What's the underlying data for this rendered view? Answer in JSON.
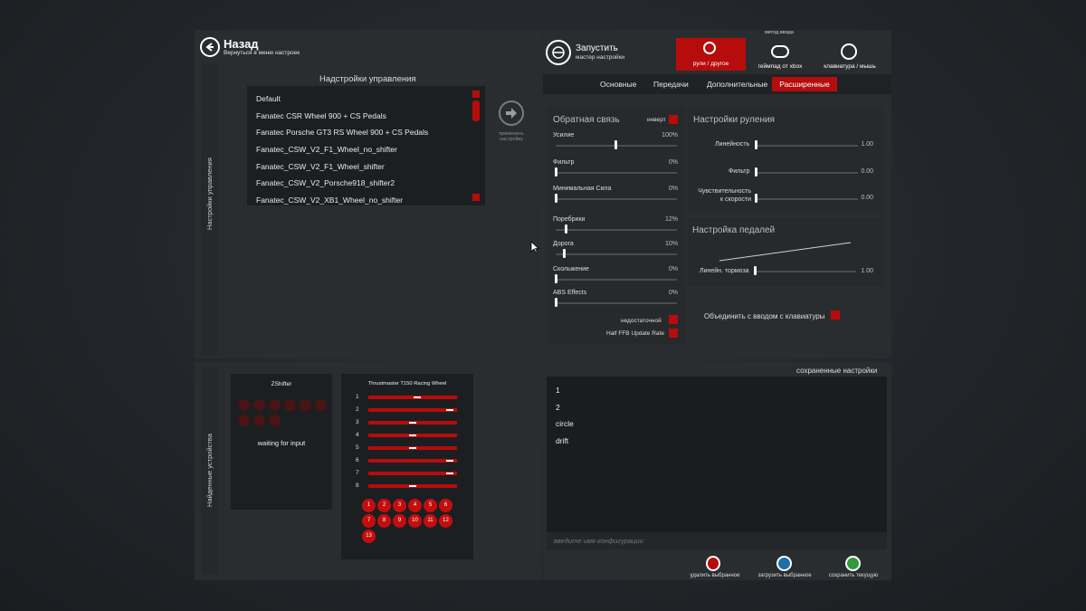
{
  "header": {
    "back_title": "Назад",
    "back_subtitle": "Вернуться в меню настроек",
    "launch_title": "Запустить",
    "launch_subtitle": "мастер настройки",
    "input_method_label": "метод ввода",
    "input_methods": [
      "рули / другое",
      "геймпад от xbox",
      "клавиатура / мышь"
    ]
  },
  "tabs": [
    "Основные",
    "Передачи",
    "Дополнительные",
    "Расширенные"
  ],
  "left": {
    "side_label_top": "Настройки управления",
    "side_label_bottom": "Найденные устройства",
    "presets_title": "Надстройки управления",
    "presets": [
      "Default",
      "Fanatec CSR Wheel 900 + CS Pedals",
      "Fanatec Porsche GT3 RS Wheel 900 + CS Pedals",
      "Fanatec_CSW_V2_F1_Wheel_no_shifter",
      "Fanatec_CSW_V2_F1_Wheel_shifter",
      "Fanatec_CSW_V2_Porsche918_shifter2",
      "Fanatec_CSW_V2_XB1_Wheel_no_shifter"
    ],
    "apply_label": "применить настройку"
  },
  "ffb": {
    "title": "Обратная связь",
    "invert_label": "инверт",
    "sliders": [
      {
        "label": "Усилие",
        "value": "100%",
        "level": 0.5
      },
      {
        "label": "Фильтр",
        "value": "0%",
        "level": 0.0
      },
      {
        "label": "Минимальная Сила",
        "value": "0%",
        "level": 0.0
      },
      {
        "label": "Поребрики",
        "value": "12%",
        "level": 0.08
      },
      {
        "label": "Дорога",
        "value": "10%",
        "level": 0.07
      },
      {
        "label": "Скольжение",
        "value": "0%",
        "level": 0.0
      },
      {
        "label": "ABS Effects",
        "value": "0%",
        "level": 0.0
      }
    ],
    "understeer_label": "недостаточной",
    "half_rate_label": "Half FFB Update Rate"
  },
  "steering": {
    "title": "Настройки руления",
    "sliders": [
      {
        "label": "Линейность",
        "value": "1.00",
        "level": 0.0
      },
      {
        "label": "Фильтр",
        "value": "0.00",
        "level": 0.0
      },
      {
        "label": "Чувствительность к скорости",
        "value": "0.00",
        "level": 0.0
      }
    ]
  },
  "pedals": {
    "title": "Настройка педалей",
    "slider": {
      "label": "Линейн. тормоза",
      "value": "1.00",
      "level": 0.0
    }
  },
  "combine_keyboard_label": "Объединить с вводом с клавиатуры",
  "devices": {
    "zshifter_title": "ZShifter",
    "zshifter_status": "waiting for input",
    "wheel_title": "Thrustmaster T150 Racing Wheel",
    "axes": [
      {
        "num": "1",
        "level": 0.55
      },
      {
        "num": "2",
        "level": 0.95
      },
      {
        "num": "3",
        "level": 0.5
      },
      {
        "num": "4",
        "level": 0.5
      },
      {
        "num": "5",
        "level": 0.5
      },
      {
        "num": "6",
        "level": 0.95
      },
      {
        "num": "7",
        "level": 0.95
      },
      {
        "num": "8",
        "level": 0.5
      }
    ],
    "buttons": [
      "1",
      "2",
      "3",
      "4",
      "5",
      "6",
      "7",
      "8",
      "9",
      "10",
      "11",
      "12",
      "13"
    ]
  },
  "saved": {
    "title": "сохраненные настройки",
    "items": [
      "1",
      "2",
      "circle",
      "drift"
    ],
    "name_placeholder": "введите имя конфигурации",
    "actions": [
      "удалить выбранное",
      "загрузить выбранное",
      "сохранить текущую"
    ]
  },
  "colors": {
    "accent": "#b60c0c",
    "panel": "#2a2d30"
  }
}
